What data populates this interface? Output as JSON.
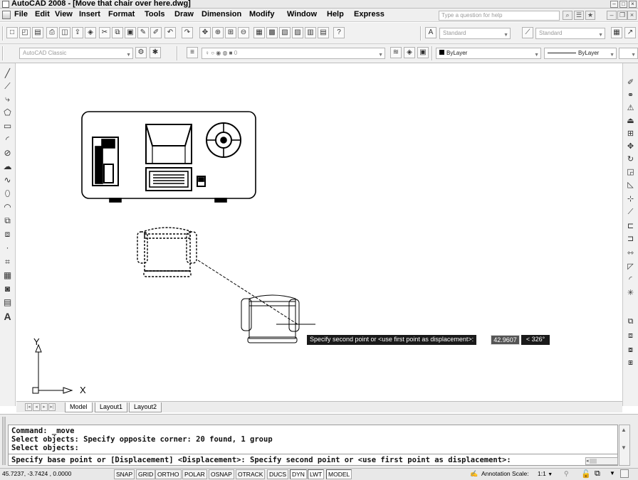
{
  "window": {
    "title": "AutoCAD 2008 - [Move that chair over here.dwg]"
  },
  "menu": {
    "items": [
      "File",
      "Edit",
      "View",
      "Insert",
      "Format",
      "Tools",
      "Draw",
      "Dimension",
      "Modify",
      "Window",
      "Help",
      "Express"
    ],
    "help_placeholder": "Type a question for help"
  },
  "toolbar": {
    "text_style": "Standard",
    "dim_style": "Standard"
  },
  "layers": {
    "workspace": "AutoCAD Classic",
    "current_layer": "0",
    "color": "ByLayer",
    "linetype": "ByLayer"
  },
  "canvas": {
    "ucs_x_label": "X",
    "ucs_y_label": "Y"
  },
  "tabs": [
    "Model",
    "Layout1",
    "Layout2"
  ],
  "dynamic_input": {
    "prompt": "Specify second point or <use first point as displacement>:",
    "distance": "42.9607",
    "angle": "< 326°"
  },
  "command_line": {
    "lines": [
      "Command: _move",
      "Select objects: Specify opposite corner: 20 found, 1 group",
      "Select objects:",
      "Specify base point or [Displacement] <Displacement>: Specify second point or <use first point as displacement>:"
    ]
  },
  "status_bar": {
    "coordinates": "45.7237, -3.7424 , 0.0000",
    "toggles": [
      "SNAP",
      "GRID",
      "ORTHO",
      "POLAR",
      "OSNAP",
      "OTRACK",
      "DUCS",
      "DYN",
      "LWT",
      "MODEL"
    ],
    "annotation_scale_label": "Annotation Scale:",
    "annotation_scale_value": "1:1"
  }
}
